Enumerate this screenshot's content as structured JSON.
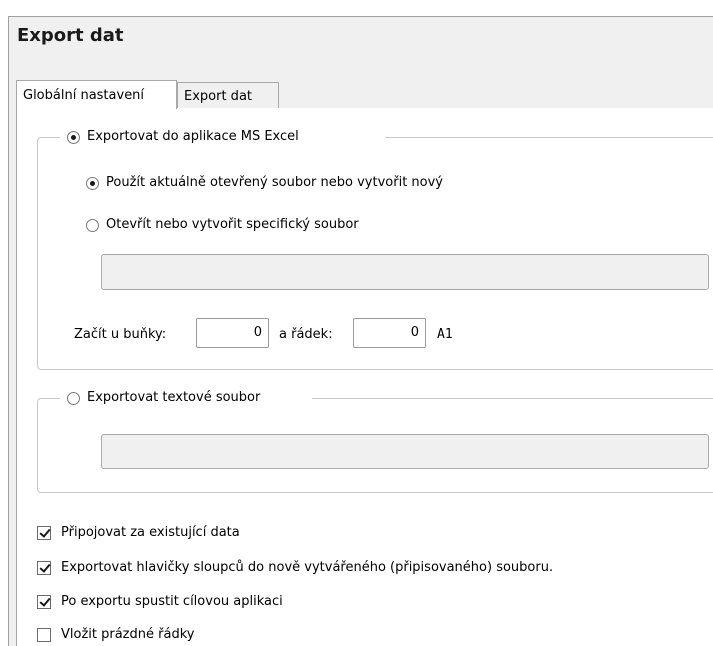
{
  "window": {
    "title": "Export dat"
  },
  "tabs": [
    {
      "label": "Globální nastavení",
      "active": true
    },
    {
      "label": "Export dat",
      "active": false
    }
  ],
  "excel_group": {
    "option_label": "Exportovat do aplikace MS Excel",
    "selected": true,
    "sub_options": [
      {
        "label": "Použít aktuálně otevřený soubor nebo vytvořit nový",
        "selected": true
      },
      {
        "label": "Otevřít nebo vytvořit specifický soubor",
        "selected": false
      }
    ],
    "file_path_value": "",
    "start_cell_label": "Začít u buňky:",
    "start_cell_value": "0",
    "row_label": "a řádek:",
    "row_value": "0",
    "cell_reference": "A1"
  },
  "text_group": {
    "option_label": "Exportovat textové soubor",
    "selected": false,
    "file_path_value": ""
  },
  "checkboxes": [
    {
      "label": "Připojovat za existující data",
      "checked": true
    },
    {
      "label": "Exportovat hlavičky sloupců do nově vytvářeného (připisovaného) souboru.",
      "checked": true
    },
    {
      "label": "Po exportu spustit cílovou aplikaci",
      "checked": true
    },
    {
      "label": "Vložit prázdné řádky",
      "checked": false
    }
  ]
}
